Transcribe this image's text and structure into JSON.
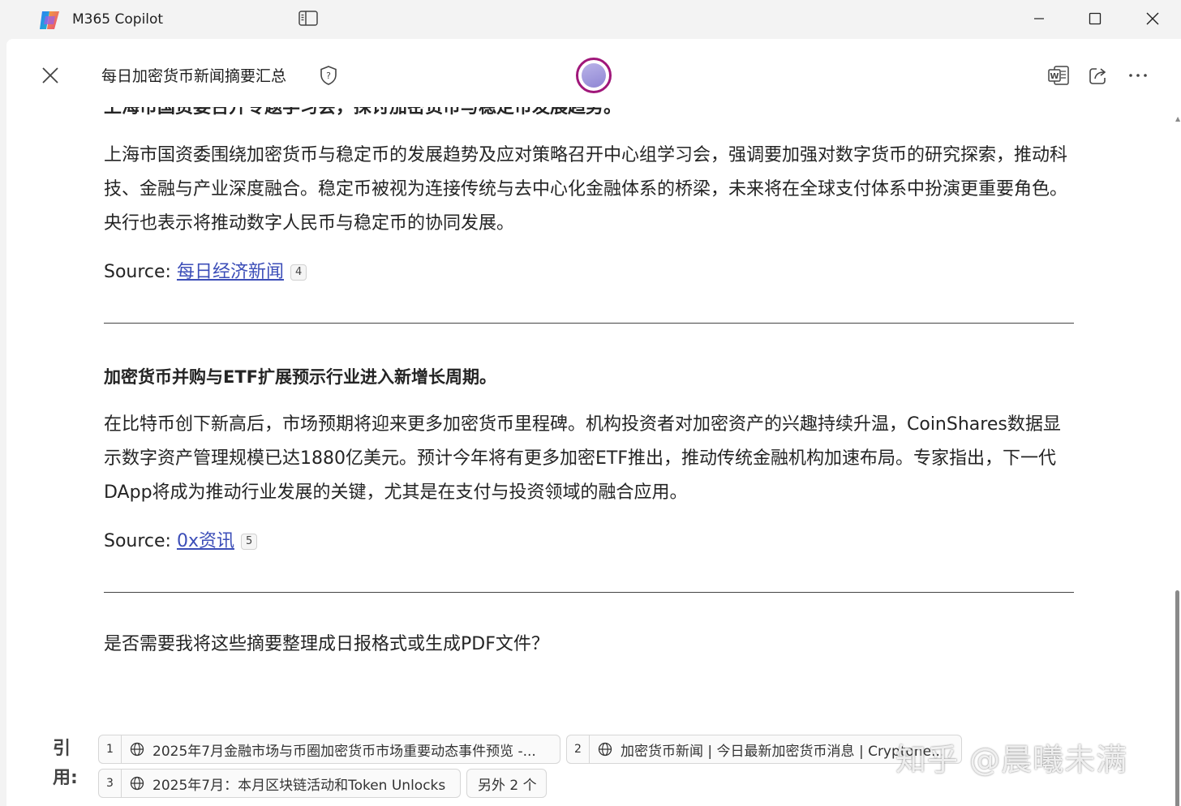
{
  "window": {
    "app_title": "M365 Copilot"
  },
  "header": {
    "doc_title": "每日加密货币新闻摘要汇总"
  },
  "content": {
    "cut_heading": "上海市国资委召开专题学习会，探讨加密货币与稳定币发展趋势。",
    "para1": "上海市国资委围绕加密货币与稳定币的发展趋势及应对策略召开中心组学习会，强调要加强对数字货币的研究探索，推动科技、金融与产业深度融合。稳定币被视为连接传统与去中心化金融体系的桥梁，未来将在全球支付体系中扮演更重要角色。央行也表示将推动数字人民币与稳定币的协同发展。",
    "source1_label": "Source: ",
    "source1_link": "每日经济新闻",
    "source1_badge": "4",
    "heading2": "加密货币并购与ETF扩展预示行业进入新增长周期。",
    "para2": "在比特币创下新高后，市场预期将迎来更多加密货币里程碑。机构投资者对加密资产的兴趣持续升温，CoinShares数据显示数字资产管理规模已达1880亿美元。预计今年将有更多加密ETF推出，推动传统金融机构加速布局。专家指出，下一代DApp将成为推动行业发展的关键，尤其是在支付与投资领域的融合应用。",
    "source2_label": "Source: ",
    "source2_link": "0x资讯",
    "source2_badge": "5",
    "closing_question": "是否需要我将这些摘要整理成日报格式或生成PDF文件？"
  },
  "citations": {
    "label": "引用:",
    "items": [
      {
        "num": "1",
        "text": "2025年7月金融市场与币圈加密货币市场重要动态事件预览 -..."
      },
      {
        "num": "2",
        "text": "加密货币新闻 | 今日最新加密货币消息 | Cryptone..."
      },
      {
        "num": "3",
        "text": "2025年7月：本月区块链活动和Token Unlocks"
      }
    ],
    "more": "另外 2 个"
  },
  "watermark": "知乎 @晨曦未满",
  "colors": {
    "link": "#3c4eb8",
    "avatar_ring": "#a0177a"
  }
}
